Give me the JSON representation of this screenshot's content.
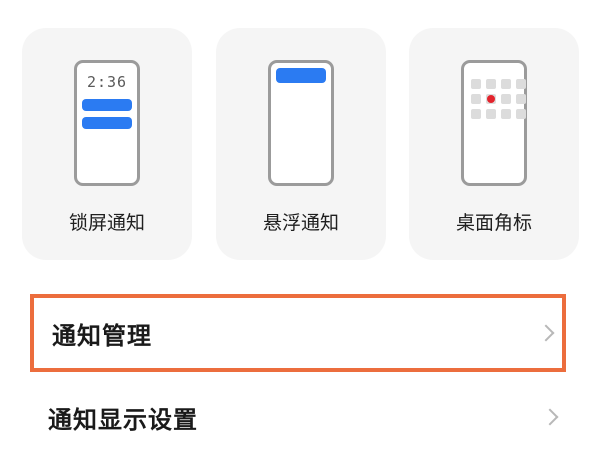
{
  "cards": [
    {
      "label": "锁屏通知",
      "time": "2:36",
      "icon": "lockscreen-notification-icon"
    },
    {
      "label": "悬浮通知",
      "icon": "floating-notification-icon"
    },
    {
      "label": "桌面角标",
      "icon": "desktop-badge-icon"
    }
  ],
  "rows": [
    {
      "label": "通知管理",
      "icon": "chevron-right-icon"
    },
    {
      "label": "通知显示设置",
      "icon": "chevron-right-icon"
    }
  ],
  "colors": {
    "accent_blue": "#2b7bf2",
    "badge_red": "#e3232c",
    "highlight_border": "#ec6d3d",
    "card_bg": "#f5f5f5"
  }
}
